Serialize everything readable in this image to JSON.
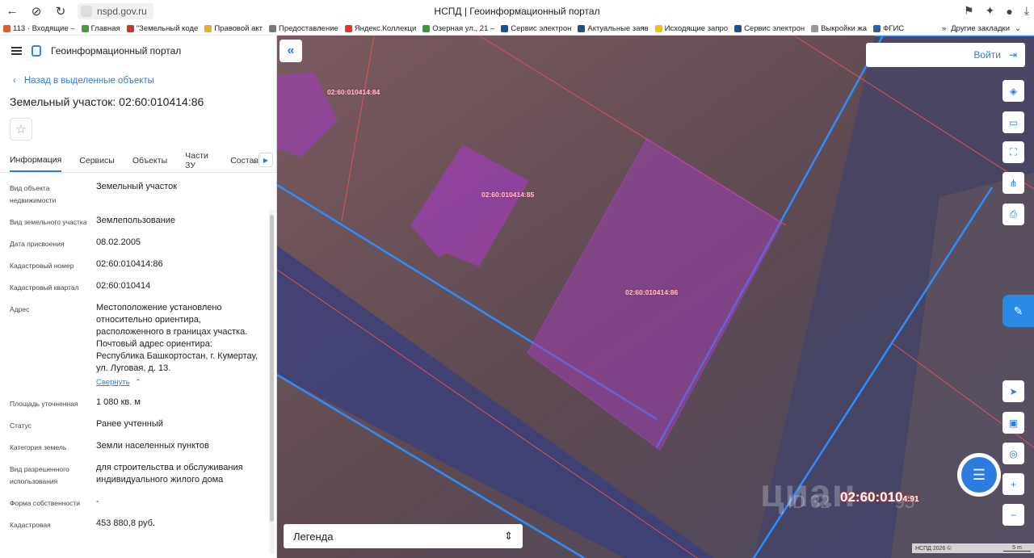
{
  "browser": {
    "url": "nspd.gov.ru",
    "tab_title": "НСПД | Геоинформационный портал",
    "bookmarks": [
      {
        "label": "113 · Входящие –",
        "color": "#e05a2b"
      },
      {
        "label": "Главная",
        "color": "#4a9a3a"
      },
      {
        "label": "\"Земельный коде",
        "color": "#c33"
      },
      {
        "label": "Правовой акт",
        "color": "#e0b12b"
      },
      {
        "label": "Предоставление",
        "color": "#777"
      },
      {
        "label": "Яндекс.Коллекци",
        "color": "#e33"
      },
      {
        "label": "Озерная ул., 21 –",
        "color": "#3a9a3a"
      },
      {
        "label": "Сервис электрон",
        "color": "#1f4f9a"
      },
      {
        "label": "Актуальные заяв",
        "color": "#1f4f9a"
      },
      {
        "label": "Исходящие запро",
        "color": "#f2c200"
      },
      {
        "label": "Сервис электрон",
        "color": "#1f4f9a"
      },
      {
        "label": "Выкройки жа",
        "color": "#999"
      },
      {
        "label": "ФГИС",
        "color": "#2b5fb0"
      }
    ],
    "other_bookmarks": "Другие закладки"
  },
  "sidebar": {
    "portal_title": "Геоинформационный портал",
    "back_link": "Назад в выделенные объекты",
    "parcel_title": "Земельный участок: 02:60:010414:86",
    "tabs": [
      "Информация",
      "Сервисы",
      "Объекты",
      "Части ЗУ",
      "Состав"
    ],
    "collapse_link": "Свернуть",
    "properties": [
      {
        "label": "Вид объекта недвижимости",
        "value": "Земельный участок"
      },
      {
        "label": "Вид земельного участка",
        "value": "Землепользование"
      },
      {
        "label": "Дата присвоения",
        "value": "08.02.2005"
      },
      {
        "label": "Кадастровый номер",
        "value": "02:60:010414:86"
      },
      {
        "label": "Кадастровый квартал",
        "value": "02:60:010414"
      },
      {
        "label": "Адрес",
        "value": "Местоположение установлено относительно ориентира, расположенного в границах участка. Почтовый адрес ориентира: Республика Башкортостан, г. Кумертау, ул. Луговая, д. 13."
      },
      {
        "label": "Площадь уточненная",
        "value": "1 080 кв. м"
      },
      {
        "label": "Статус",
        "value": "Ранее учтенный"
      },
      {
        "label": "Категория земель",
        "value": "Земли населенных пунктов"
      },
      {
        "label": "Вид разрешенного использования",
        "value": "для строительства и обслуживания индивидуального жилого дома"
      },
      {
        "label": "Форма собственности",
        "value": "-"
      },
      {
        "label": "Кадастровая",
        "value": "453 880,8 руб."
      }
    ]
  },
  "map": {
    "login_label": "Войти",
    "legend_label": "Легенда",
    "parcel_labels": [
      "02:60:010414:84",
      "02:60:010414:85",
      "02:60:010414:86"
    ],
    "large_label": "02:60:010",
    "large_label_suffix": "4:91",
    "watermark": "циан",
    "watermark_id": "ID 32",
    "watermark_id_tail": "95",
    "attribution": "НСПД 2026 ©",
    "scale_label": "5 m",
    "colors": {
      "accent": "#2b7de0",
      "parcel_fill": "#9b3fb0",
      "boundary_blue": "#2f8cff",
      "boundary_red": "#d9545a"
    }
  }
}
